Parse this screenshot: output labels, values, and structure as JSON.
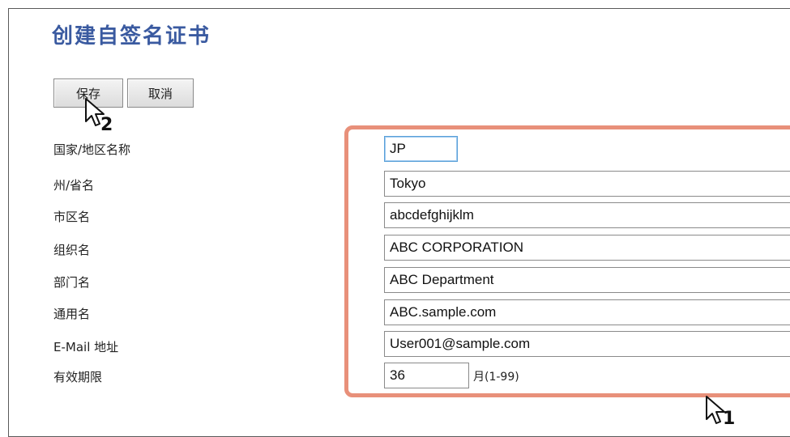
{
  "title": "创建自签名证书",
  "buttons": {
    "save_label": "保存",
    "cancel_label": "取消"
  },
  "fields": [
    {
      "label": "国家/地区名称",
      "value": "JP"
    },
    {
      "label": "州/省名",
      "value": "Tokyo"
    },
    {
      "label": "市区名",
      "value": "abcdefghijklm"
    },
    {
      "label": "组织名",
      "value": "ABC CORPORATION"
    },
    {
      "label": "部门名",
      "value": "ABC Department"
    },
    {
      "label": "通用名",
      "value": "ABC.sample.com"
    },
    {
      "label": "E-Mail 地址",
      "value": "User001@sample.com"
    },
    {
      "label": "有效期限",
      "value": "36",
      "suffix": "月(1-99)"
    }
  ],
  "annotations": {
    "step1": "1",
    "step2": "2",
    "highlight_color": "#e8907a"
  },
  "icons": [
    "pointer-cursor-icon",
    "pointer-cursor-icon"
  ]
}
